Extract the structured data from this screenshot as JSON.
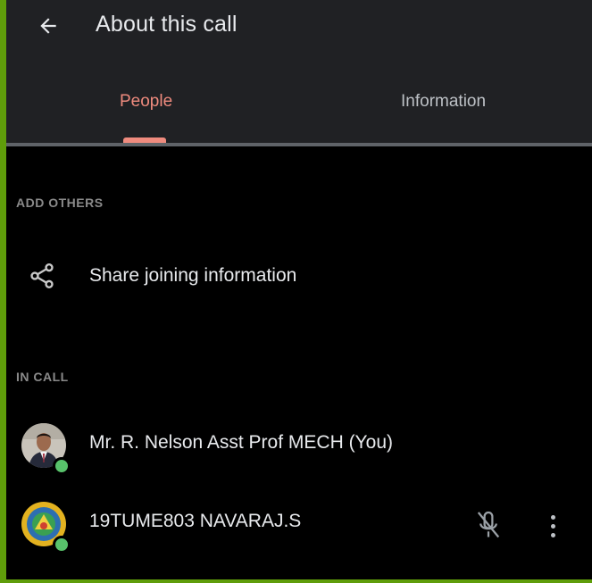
{
  "header": {
    "title": "About this call",
    "tabs": [
      {
        "label": "People",
        "active": true
      },
      {
        "label": "Information",
        "active": false
      }
    ]
  },
  "sections": {
    "add_others": {
      "label": "ADD OTHERS",
      "share_label": "Share joining information",
      "share_icon": "share-icon"
    },
    "in_call": {
      "label": "IN CALL",
      "participants": [
        {
          "name": "Mr. R. Nelson Asst Prof MECH (You)",
          "online": true
        },
        {
          "name": "19TUME803 NAVARAJ.S",
          "online": true,
          "muted": true
        }
      ]
    }
  },
  "colors": {
    "accent": "#ef8b7e",
    "header_bg": "#202124",
    "border": "#5f9d0a",
    "online": "#58c26b"
  }
}
